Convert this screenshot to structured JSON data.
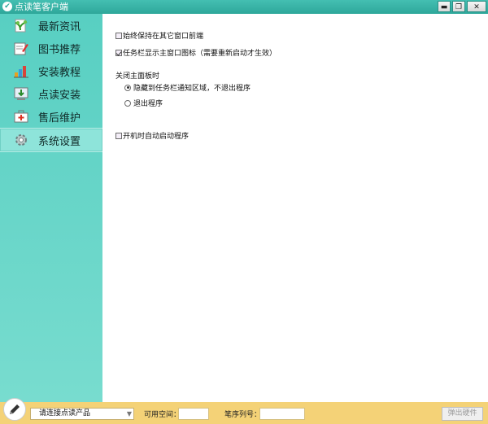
{
  "window": {
    "title": "点读笔客户端",
    "controls": {
      "minimize": "▬",
      "restore": "❐",
      "close": "✕"
    }
  },
  "sidebar": {
    "items": [
      {
        "label": "最新资讯",
        "icon": "news-plant-icon",
        "active": false
      },
      {
        "label": "图书推荐",
        "icon": "book-edit-icon",
        "active": false
      },
      {
        "label": "安装教程",
        "icon": "bar-chart-icon",
        "active": false
      },
      {
        "label": "点读安装",
        "icon": "download-install-icon",
        "active": false
      },
      {
        "label": "售后维护",
        "icon": "medical-kit-icon",
        "active": false
      },
      {
        "label": "系统设置",
        "icon": "gear-icon",
        "active": true
      }
    ]
  },
  "settings": {
    "always_on_top": {
      "label": "始终保持在其它窗口前端",
      "checked": false
    },
    "taskbar_icon": {
      "label": "任务栏显示主窗口图标（需要重新启动才生效）",
      "checked": true
    },
    "close_group_label": "关闭主面板时",
    "close_options": [
      {
        "label": "隐藏到任务栏通知区域，不退出程序",
        "selected": true
      },
      {
        "label": "退出程序",
        "selected": false
      }
    ],
    "autostart": {
      "label": "开机时自动启动程序",
      "checked": false
    }
  },
  "bottom": {
    "device_select": "请连接点读产品",
    "available_space_label": "可用空间：",
    "available_space_value": "",
    "serial_label": "笔序列号：",
    "serial_value": "",
    "eject_button": "弹出硬件"
  },
  "colors": {
    "titlebar": "#2ea79a",
    "sidebar": "#5fd2c5",
    "sidebar_active": "#8ee4da",
    "bottombar": "#f4d277"
  }
}
